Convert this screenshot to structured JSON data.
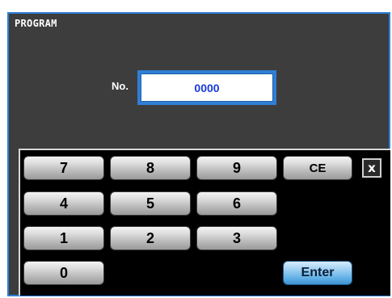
{
  "window": {
    "title": "PROGRAM"
  },
  "program": {
    "label": "No.",
    "value": "0000"
  },
  "keypad": {
    "keys": {
      "k7": "7",
      "k8": "8",
      "k9": "9",
      "ce": "CE",
      "k4": "4",
      "k5": "5",
      "k6": "6",
      "k1": "1",
      "k2": "2",
      "k3": "3",
      "k0": "0",
      "enter": "Enter"
    },
    "close_icon": "close-icon",
    "close_glyph": "x"
  },
  "colors": {
    "window_border": "#2f7fd6",
    "window_bg": "#3d3d3d",
    "value_text": "#1a3bd6",
    "enter_key": "#5eaee6"
  }
}
